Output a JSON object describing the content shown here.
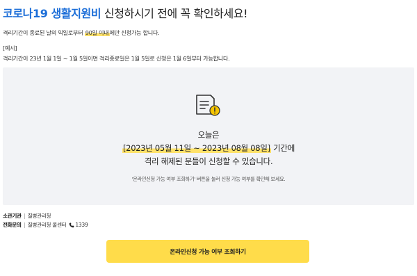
{
  "title": {
    "highlight": "코로나19 생활지원비",
    "rest": " 신청하시기 전에 꼭 확인하세요!"
  },
  "notice": {
    "line_before": "격리기간이 종료된 날의 익일로부터 ",
    "line_highlight": "90일 이내",
    "line_after": "에만 신청가능 합니다.",
    "example_label": "[예시]",
    "example_text": "격리기간이 23년 1월 1일 ~ 1월 5일이면 격리종료일은 1월 5일로 신청은 1월 6일부터 가능합니다."
  },
  "status_box": {
    "icon": "document-warning-icon",
    "today_label": "오늘은",
    "date_range": "[2023년 05월 11일 ~ 2023년 08월 08일]",
    "date_suffix": " 기간에",
    "message": "격리 해제된 분들이 신청할 수 있습니다.",
    "note": "'온라인신청 가능 여부 조회하기' 버튼을 눌러 신청 가능 여부를 확인해 보세요."
  },
  "info": {
    "agency_label": "소관기관",
    "agency_value": "질병관리청",
    "contact_label": "전화문의",
    "contact_value": "질병관리청 콜센터",
    "phone_icon": "phone-icon",
    "phone_number": "1339"
  },
  "action": {
    "button_label": "온라인신청 가능 여부 조회하기"
  },
  "colors": {
    "accent_blue": "#1c6ed8",
    "highlight_yellow": "#ffe26a",
    "button_yellow": "#ffdc4a",
    "box_gray": "#f2f3f6",
    "warning_yellow": "#f5c400"
  }
}
